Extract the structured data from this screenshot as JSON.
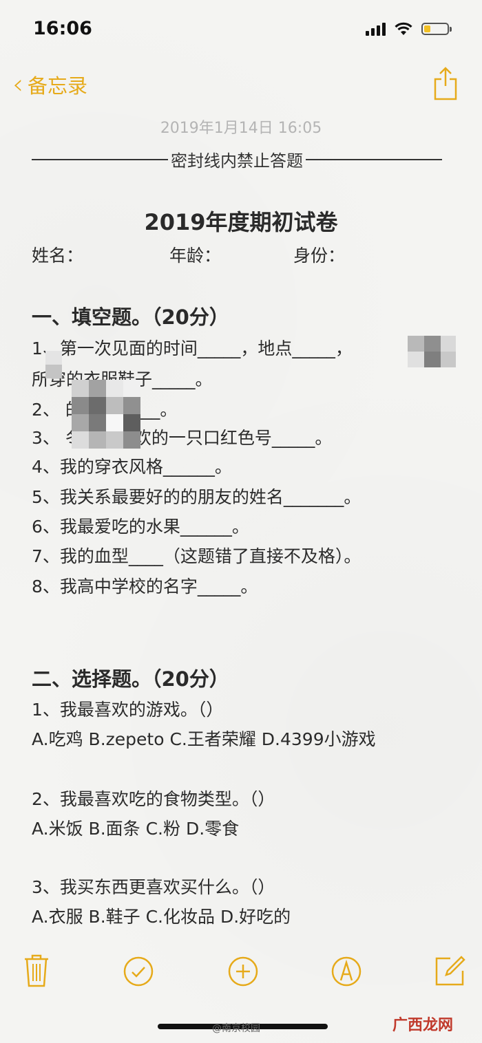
{
  "status_bar": {
    "time": "16:06"
  },
  "nav": {
    "back_label": "备忘录"
  },
  "note": {
    "date": "2019年1月14日 16:05",
    "seal_text": "密封线内禁止答题",
    "title": "2019年度期初试卷",
    "fields": {
      "name": "姓名：",
      "age": "年龄：",
      "identity": "身份："
    },
    "section1": {
      "heading": "一、填空题。（20分）",
      "lines": [
        "1、第一次见面的时间_____，地点_____，",
        "所穿的衣服鞋子_____。",
        "2、     的鞋码_____。",
        "3、     冬天最喜欢的一只口红色号_____。",
        "4、我的穿衣风格______。",
        "5、我关系最要好的的朋友的姓名_______。",
        "6、我最爱吃的水果______。",
        "7、我的血型____（这题错了直接不及格）。",
        "8、我高中学校的名字_____。"
      ]
    },
    "section2": {
      "heading": "二、选择题。（20分）",
      "lines": [
        "1、我最喜欢的游戏。（）",
        "A.吃鸡 B.zepeto C.王者荣耀 D.4399小游戏",
        "2、我最喜欢吃的食物类型。（）",
        "A.米饭 B.面条 C.粉 D.零食",
        "3、我买东西更喜欢买什么。（）",
        "A.衣服 B.鞋子 C.化妆品 D.好吃的"
      ]
    }
  },
  "toolbar": {
    "icons": [
      "trash-icon",
      "checklist-icon",
      "add-icon",
      "markup-icon",
      "compose-icon"
    ]
  },
  "watermarks": {
    "weibo": "@南京校园",
    "site": "广西龙网"
  },
  "colors": {
    "accent": "#e6aa1a",
    "battery": "#f2c025"
  }
}
